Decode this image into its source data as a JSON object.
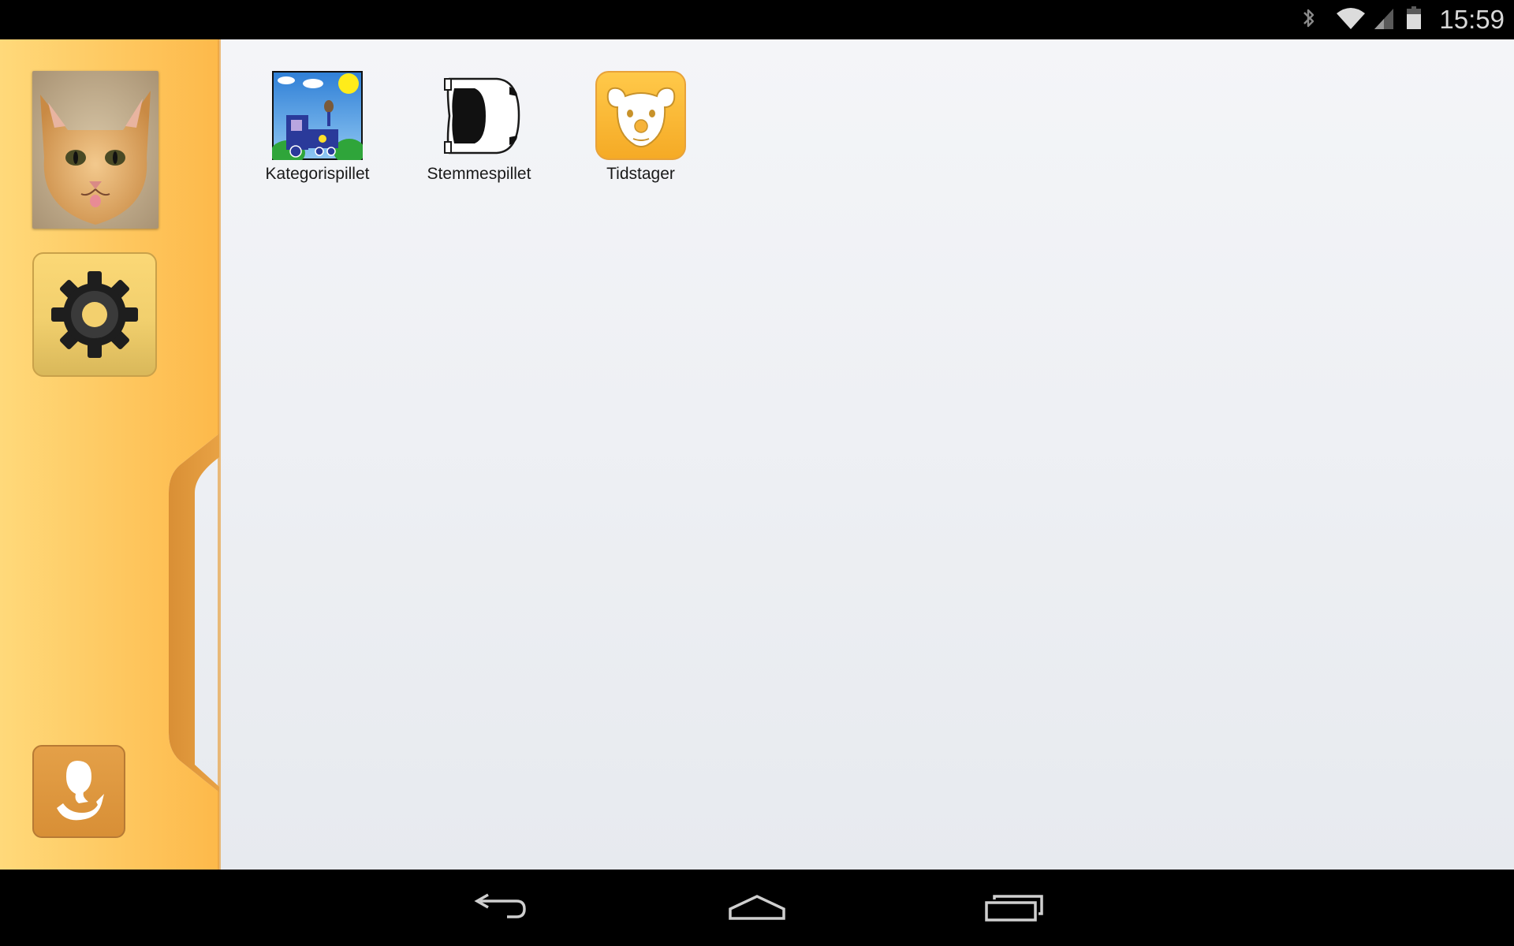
{
  "status_bar": {
    "time": "15:59",
    "icons": [
      "bluetooth-icon",
      "wifi-icon",
      "cell-signal-icon",
      "battery-icon"
    ]
  },
  "sidebar": {
    "profile_photo": "kitten-photo",
    "settings_icon": "gear-icon",
    "switch_user_icon": "switch-user-icon",
    "colors": {
      "panel_light": "#ffd97a",
      "panel_dark": "#fdb94a",
      "tab_edge": "#e09a3a"
    }
  },
  "apps": [
    {
      "label": "Kategorispillet",
      "icon": "train-icon"
    },
    {
      "label": "Stemmespillet",
      "icon": "car-icon"
    },
    {
      "label": "Tidstager",
      "icon": "koala-icon"
    }
  ],
  "nav_bar": {
    "buttons": [
      "back-icon",
      "home-icon",
      "recents-icon"
    ]
  }
}
